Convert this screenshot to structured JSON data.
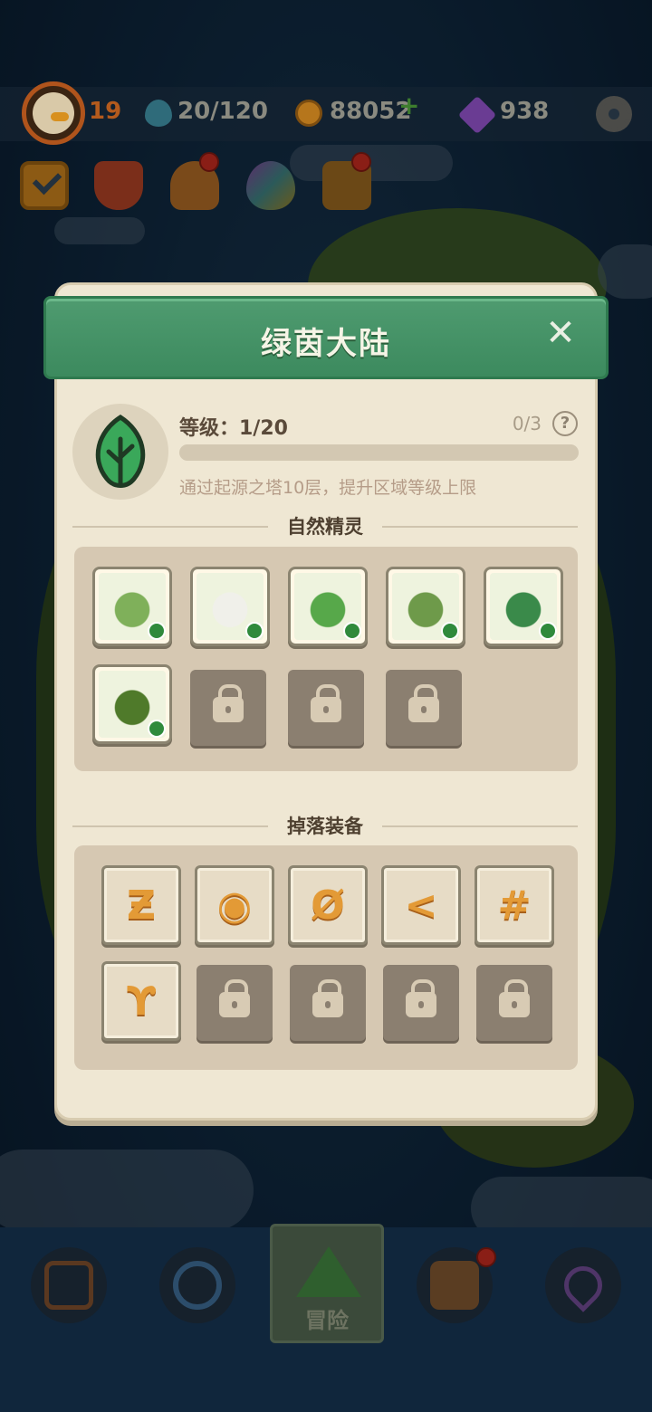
{
  "hud": {
    "player_level": "19",
    "stamina": "20/120",
    "coins": "88052",
    "gems": "938"
  },
  "bottom_nav": {
    "active_label": "冒险"
  },
  "dialog": {
    "title": "绿茵大陆",
    "level_label": "等级：1/20",
    "progress_count": "0/3",
    "progress_fraction": 0,
    "help_symbol": "?",
    "hint": "通过起源之塔10层，提升区域等级上限",
    "spirits_title": "自然精灵",
    "spirits": [
      {
        "name": "green-rabbit-dragon",
        "color": "#7fb05a"
      },
      {
        "name": "panda",
        "color": "#f0f0ea"
      },
      {
        "name": "green-parrot",
        "color": "#57a84a"
      },
      {
        "name": "cactus-boxer",
        "color": "#6e9a4a"
      },
      {
        "name": "green-snake",
        "color": "#3a8a4a"
      },
      {
        "name": "hooded-shadow",
        "color": "#4f7a2a"
      }
    ],
    "spirit_locked_count": 3,
    "equipment_title": "掉落装备",
    "equipment": [
      {
        "name": "rune-z",
        "glyph": "Ƶ"
      },
      {
        "name": "rune-eye",
        "glyph": "◉"
      },
      {
        "name": "rune-slashed-circle",
        "glyph": "Ø"
      },
      {
        "name": "rune-angle",
        "glyph": "<"
      },
      {
        "name": "rune-hash",
        "glyph": "#"
      },
      {
        "name": "rune-arch",
        "glyph": "ϒ"
      }
    ],
    "equipment_locked_count": 4
  },
  "colors": {
    "banner_green": "#3c8a5e",
    "panel_bg": "#efe7d3",
    "rune_orange": "#e39a36",
    "element_leaf": "#2f8a3c"
  }
}
